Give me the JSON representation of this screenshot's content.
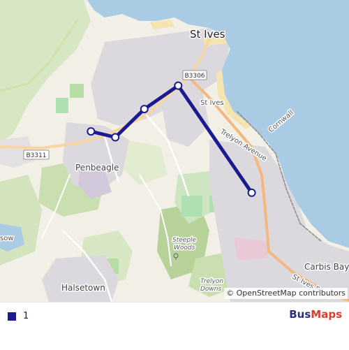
{
  "map": {
    "places": {
      "st_ives": "St Ives",
      "st_ives_small": "St Ives",
      "penbeagle": "Penbeagle",
      "halsetown": "Halsetown",
      "carbis_bay": "Carbis Bay",
      "steeple_woods": "Steeple\nWoods",
      "trelyon_downs": "Trelyon\nDowns",
      "sow": "sow"
    },
    "roads": {
      "b3306": "B3306",
      "b3311": "B3311",
      "trelyon_avenue": "Trelyon Avenue",
      "st_ives_road": "St Ives Road",
      "cornwall": "Cornwall"
    },
    "route": {
      "color": "#1b1b8f",
      "stops": [
        {
          "lat": 50.2055,
          "lon": -5.4958
        },
        {
          "lat": 50.2049,
          "lon": -5.4912
        },
        {
          "lat": 50.2078,
          "lon": -5.4857
        },
        {
          "lat": 50.2102,
          "lon": -5.4793
        },
        {
          "lat": 50.1992,
          "lon": -5.4654
        }
      ]
    },
    "attribution": "© OpenStreetMap contributors"
  },
  "legend": {
    "items": [
      {
        "label": "1",
        "color": "#1b1b8f"
      }
    ]
  },
  "brand": {
    "part1": "Bus",
    "part2": "Maps"
  },
  "colors": {
    "sea": "#a9cbe3",
    "land": "#f2efe6",
    "urban": "#dcd9de",
    "green": "#c9dfb0",
    "park": "#b7dca5",
    "road": "#ffffff",
    "main_road": "#f7d6a2",
    "beach": "#f5e3b0"
  }
}
